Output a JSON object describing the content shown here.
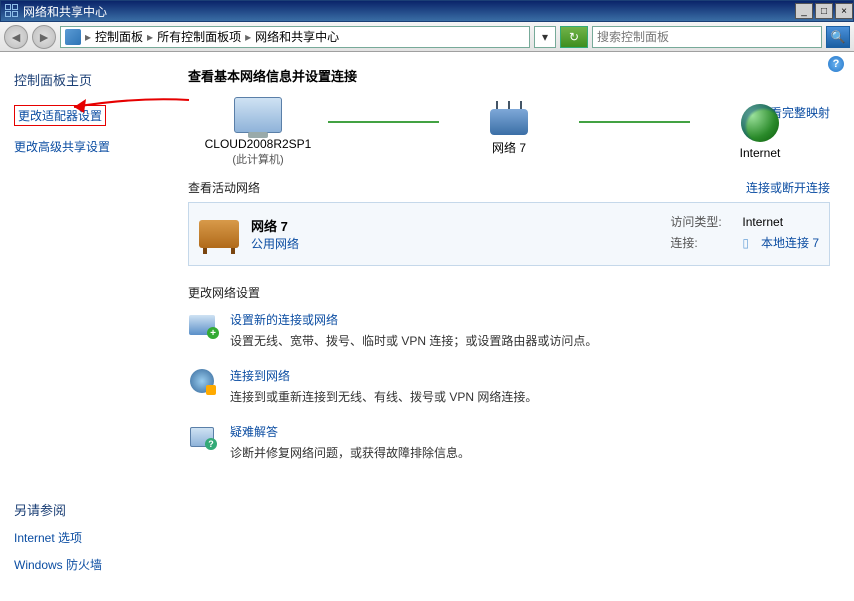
{
  "window": {
    "title": "网络和共享中心"
  },
  "breadcrumb": {
    "p1": "控制面板",
    "p2": "所有控制面板项",
    "p3": "网络和共享中心"
  },
  "search": {
    "placeholder": "搜索控制面板"
  },
  "sidebar": {
    "home": "控制面板主页",
    "adapter": "更改适配器设置",
    "advanced": "更改高级共享设置",
    "see_also_title": "另请参阅",
    "see_also": [
      "Internet 选项",
      "Windows 防火墙"
    ]
  },
  "content": {
    "heading": "查看基本网络信息并设置连接",
    "map_link": "查看完整映射",
    "nodes": {
      "local_name": "CLOUD2008R2SP1",
      "local_sub": "(此计算机)",
      "network_label": "网络  7",
      "internet_label": "Internet"
    },
    "active_title": "查看活动网络",
    "active_link": "连接或断开连接",
    "card": {
      "name": "网络  7",
      "type": "公用网络",
      "access_label": "访问类型:",
      "access_value": "Internet",
      "conn_label": "连接:",
      "conn_value": "本地连接 7"
    },
    "change_title": "更改网络设置",
    "options": [
      {
        "title": "设置新的连接或网络",
        "desc": "设置无线、宽带、拨号、临时或 VPN 连接；或设置路由器或访问点。"
      },
      {
        "title": "连接到网络",
        "desc": "连接到或重新连接到无线、有线、拨号或 VPN 网络连接。"
      },
      {
        "title": "疑难解答",
        "desc": "诊断并修复网络问题，或获得故障排除信息。"
      }
    ]
  }
}
